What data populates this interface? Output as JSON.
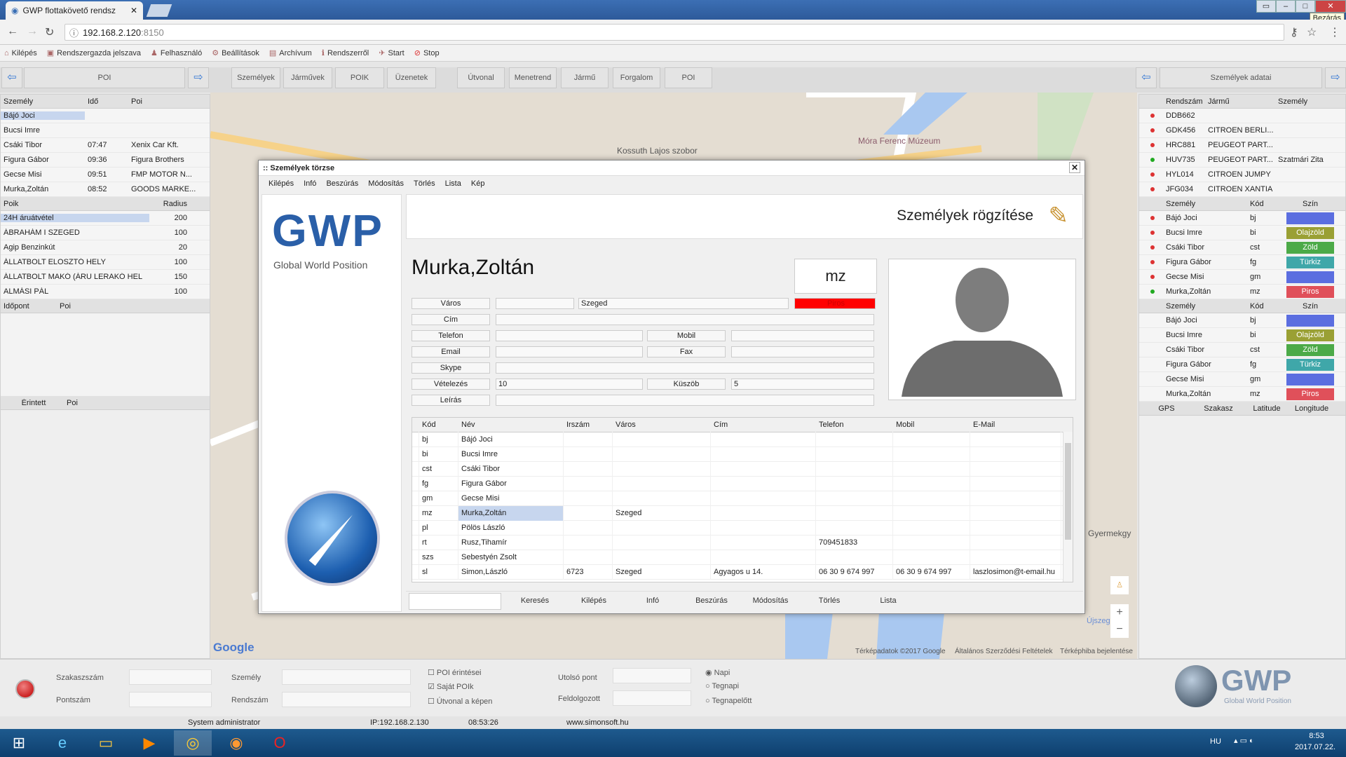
{
  "browser": {
    "tab_title": "GWP flottakövető rendsz",
    "url_host": "192.168.2.120",
    "url_port": ":8150",
    "tooltip": "Bezárás"
  },
  "bookmarks": [
    {
      "label": "Kilépés"
    },
    {
      "label": "Rendszergazda jelszava"
    },
    {
      "label": "Felhasználó"
    },
    {
      "label": "Beállítások"
    },
    {
      "label": "Archívum"
    },
    {
      "label": "Rendszerről"
    },
    {
      "label": "Start"
    },
    {
      "label": "Stop"
    }
  ],
  "toolbar": {
    "left_title": "POI",
    "right_title": "Személyek adatai",
    "tabs": [
      "Személyek",
      "Járművek",
      "POIK",
      "Üzenetek",
      "Útvonal",
      "Menetrend",
      "Jármű",
      "Forgalom",
      "POI"
    ]
  },
  "left": {
    "persons_headers": [
      "Személy",
      "Idő",
      "Poi"
    ],
    "persons": [
      [
        "Bájó Joci",
        "",
        ""
      ],
      [
        "Bucsi Imre",
        "",
        ""
      ],
      [
        "Csáki Tibor",
        "07:47",
        "Xenix Car Kft."
      ],
      [
        "Figura Gábor",
        "09:36",
        "Figura Brothers"
      ],
      [
        "Gecse Misi",
        "09:51",
        "FMP MOTOR N..."
      ],
      [
        "Murka,Zoltán",
        "08:52",
        "GOODS MARKE..."
      ]
    ],
    "poi_headers": [
      "Poik",
      "Radius"
    ],
    "pois": [
      [
        "24H áruátvétel",
        "200"
      ],
      [
        "ÁBRAHÁM I SZEGED",
        "100"
      ],
      [
        "Agip Benzinkút",
        "20"
      ],
      [
        "ÁLLATBOLT ELOSZTÓ HELY",
        "100"
      ],
      [
        "ÁLLATBOLT MAKÓ (ÁRU LERAKÓ HEL",
        "150"
      ],
      [
        "ALMÁSI PÁL",
        "100"
      ]
    ],
    "time_headers": [
      "Időpont",
      "Poi"
    ],
    "touch_headers": [
      "Érintett",
      "Poi"
    ]
  },
  "right": {
    "veh_headers": [
      "Rendszám",
      "Jármű",
      "Személy"
    ],
    "vehicles": [
      [
        "DDB662",
        "",
        "",
        "#d33"
      ],
      [
        "GDK456",
        "CITROEN BERLI...",
        "",
        "#d33"
      ],
      [
        "HRC881",
        "PEUGEOT PART...",
        "",
        "#d33"
      ],
      [
        "HUV735",
        "PEUGEOT PART...",
        "Szatmári Zita",
        "#2a2"
      ],
      [
        "HYL014",
        "CITROEN JUMPY",
        "",
        "#d33"
      ],
      [
        "JFG034",
        "CITROEN XANTIA",
        "",
        "#d33"
      ]
    ],
    "p_headers": [
      "Személy",
      "Kód",
      "Szín"
    ],
    "people1": [
      [
        "Bájó Joci",
        "bj",
        "",
        "#5b6ee0",
        "#d33"
      ],
      [
        "Bucsi Imre",
        "bi",
        "Olajzöld",
        "#9aa034",
        "#d33"
      ],
      [
        "Csáki Tibor",
        "cst",
        "Zöld",
        "#4caa48",
        "#d33"
      ],
      [
        "Figura Gábor",
        "fg",
        "Türkiz",
        "#3fa7a9",
        "#d33"
      ],
      [
        "Gecse Misi",
        "gm",
        "",
        "#5b6ee0",
        "#d33"
      ],
      [
        "Murka,Zoltán",
        "mz",
        "Piros",
        "#e0505a",
        "#2a2"
      ]
    ],
    "people2": [
      [
        "Bájó Joci",
        "bj",
        "",
        "#5b6ee0"
      ],
      [
        "Bucsi Imre",
        "bi",
        "Olajzöld",
        "#9aa034"
      ],
      [
        "Csáki Tibor",
        "cst",
        "Zöld",
        "#4caa48"
      ],
      [
        "Figura Gábor",
        "fg",
        "Türkiz",
        "#3fa7a9"
      ],
      [
        "Gecse Misi",
        "gm",
        "",
        "#5b6ee0"
      ],
      [
        "Murka,Zoltán",
        "mz",
        "Piros",
        "#e0505a"
      ]
    ],
    "gps_headers": [
      "GPS",
      "Szakasz",
      "Latitude",
      "Longitude"
    ]
  },
  "map": {
    "labels": [
      "Móra Ferenc Múzeum",
      "Kossuth Lajos szobor",
      "Google",
      "Térképadatok ©2017 Google",
      "Általános Szerződési Feltételek",
      "Térképhiba bejelentése",
      "Gyermekgy",
      "Újszeged"
    ]
  },
  "dialog": {
    "title": ":: Személyek törzse",
    "menu": [
      "Kilépés",
      "Infó",
      "Beszúrás",
      "Módosítás",
      "Törlés",
      "Lista",
      "Kép"
    ],
    "logo_text": "GWP",
    "logo_sub": "Global World Position",
    "heading": "Személyek rögzítése",
    "name": "Murka,Zoltán",
    "code": "mz",
    "labels": {
      "city": "Város",
      "address": "Cím",
      "phone": "Telefon",
      "mobile": "Mobil",
      "email": "Email",
      "fax": "Fax",
      "skype": "Skype",
      "purchase": "Vételezés",
      "threshold": "Küszöb",
      "desc": "Leírás"
    },
    "values": {
      "city": "Szeged",
      "color": "Piros",
      "purchase": "10",
      "threshold": "5"
    },
    "grid_headers": [
      "Kód",
      "Név",
      "Irszám",
      "Város",
      "Cím",
      "Telefon",
      "Mobil",
      "E-Mail"
    ],
    "grid": [
      [
        "bj",
        "Bájó Joci",
        "",
        "",
        "",
        "",
        "",
        ""
      ],
      [
        "bi",
        "Bucsi Imre",
        "",
        "",
        "",
        "",
        "",
        ""
      ],
      [
        "cst",
        "Csáki Tibor",
        "",
        "",
        "",
        "",
        "",
        ""
      ],
      [
        "fg",
        "Figura Gábor",
        "",
        "",
        "",
        "",
        "",
        ""
      ],
      [
        "gm",
        "Gecse Misi",
        "",
        "",
        "",
        "",
        "",
        ""
      ],
      [
        "mz",
        "Murka,Zoltán",
        "",
        "Szeged",
        "",
        "",
        "",
        ""
      ],
      [
        "pl",
        "Pölös László",
        "",
        "",
        "",
        "",
        "",
        ""
      ],
      [
        "rt",
        "Rusz,Tihamír",
        "",
        "",
        "",
        "709451833",
        "",
        ""
      ],
      [
        "szs",
        "Sebestyén Zsolt",
        "",
        "",
        "",
        "",
        "",
        ""
      ],
      [
        "sl",
        "Simon,László",
        "6723",
        "Szeged",
        "Agyagos u 14.",
        "06 30 9 674 997",
        "06 30 9 674 997",
        "laszlosimon@t-email.hu"
      ]
    ],
    "bottom_buttons": [
      "Keresés",
      "Kilépés",
      "Infó",
      "Beszúrás",
      "Módosítás",
      "Törlés",
      "Lista"
    ]
  },
  "bottom": {
    "section_no": "Szakaszszám",
    "point_no": "Pontszám",
    "person": "Személy",
    "plate": "Rendszám",
    "poi_touch": "POI érintései",
    "own_poi": "Saját POIk",
    "route": "Útvonal a képen",
    "last_point": "Utolsó pont",
    "processed": "Feldolgozott",
    "daily": "Napi",
    "yesterday": "Tegnapi",
    "daybefore": "Tegnapelőtt"
  },
  "status": {
    "user": "System administrator",
    "ip": "IP:192.168.2.130",
    "time": "08:53:26",
    "site": "www.simonsoft.hu"
  },
  "taskbar": {
    "lang": "HU",
    "clock": "8:53",
    "date": "2017.07.22."
  }
}
